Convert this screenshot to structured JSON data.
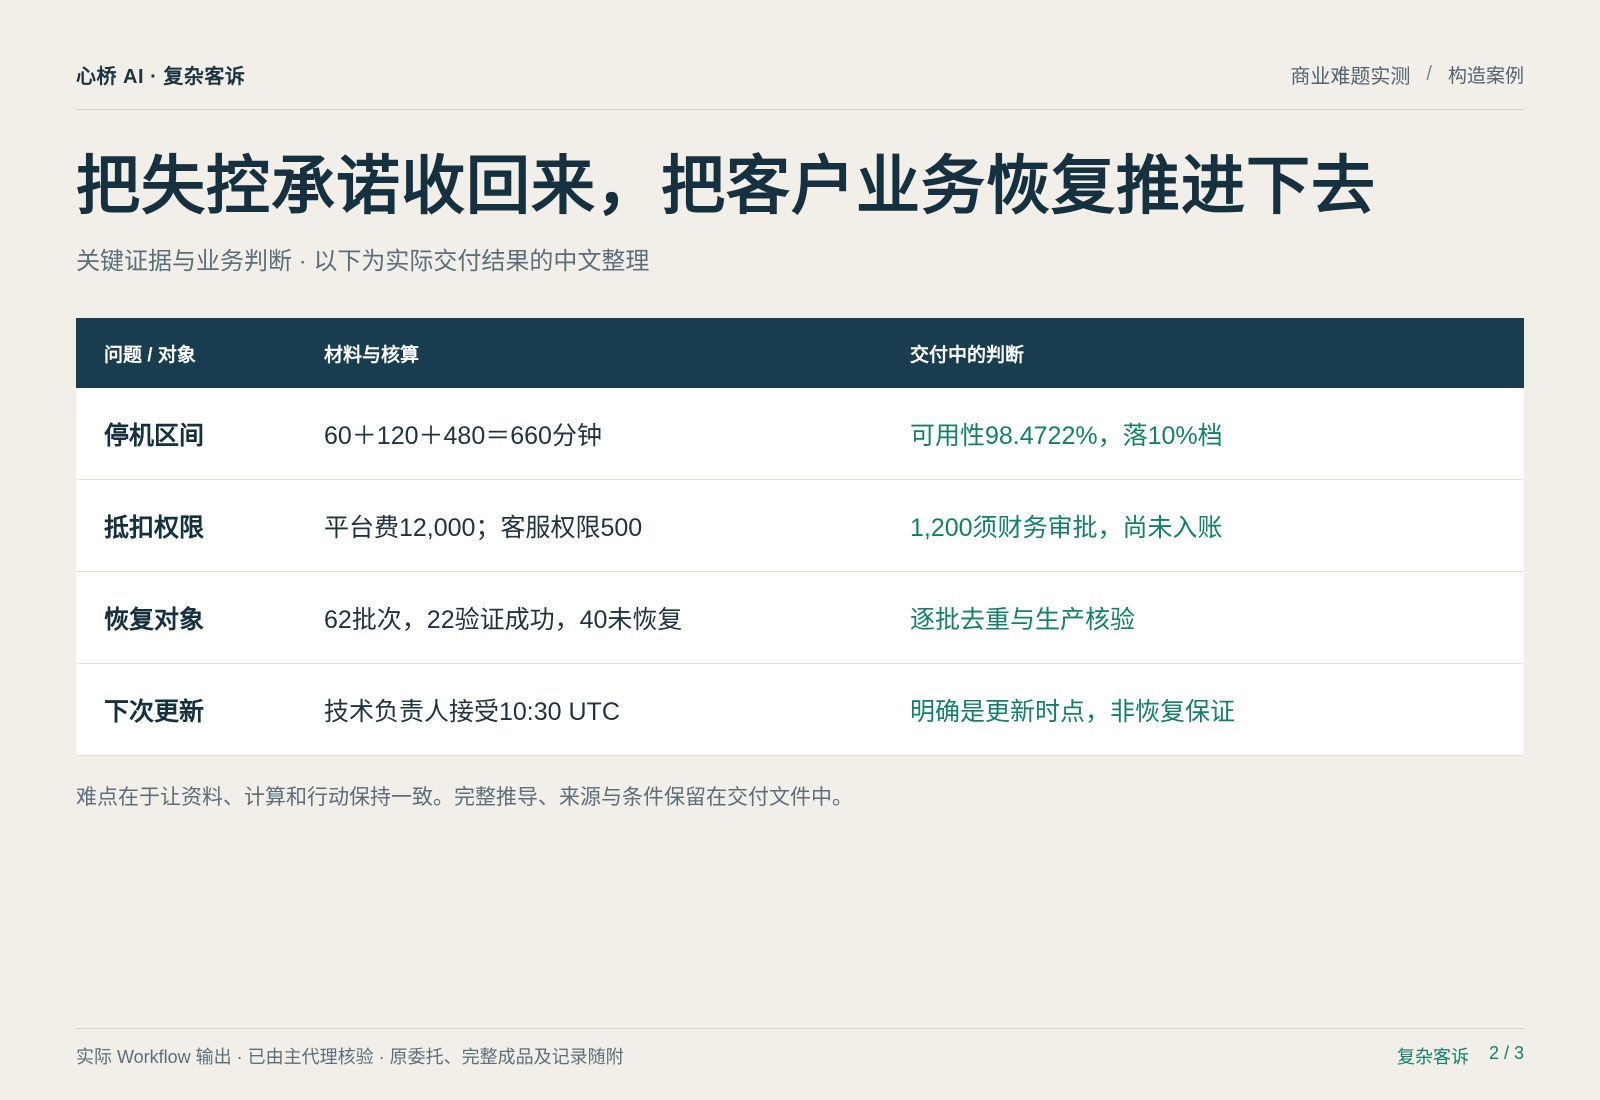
{
  "header": {
    "brand": "心桥 AI · 复杂客诉",
    "crumb1": "商业难题实测",
    "separator": "/",
    "crumb2": "构造案例"
  },
  "title": "把失控承诺收回来，把客户业务恢复推进下去",
  "subtitle": "关键证据与业务判断 · 以下为实际交付结果的中文整理",
  "table": {
    "headers": [
      "问题 / 对象",
      "材料与核算",
      "交付中的判断"
    ],
    "rows": [
      [
        "停机区间",
        "60＋120＋480＝660分钟",
        "可用性98.4722%，落10%档"
      ],
      [
        "抵扣权限",
        "平台费12,000；客服权限500",
        "1,200须财务审批，尚未入账"
      ],
      [
        "恢复对象",
        "62批次，22验证成功，40未恢复",
        "逐批去重与生产核验"
      ],
      [
        "下次更新",
        "技术负责人接受10:30 UTC",
        "明确是更新时点，非恢复保证"
      ]
    ]
  },
  "note": "难点在于让资料、计算和行动保持一致。完整推导、来源与条件保留在交付文件中。",
  "footer": {
    "left": "实际 Workflow 输出 · 已由主代理核验 · 原委托、完整成品及记录随附",
    "section": "复杂客诉",
    "page": "2 / 3"
  },
  "colors": {
    "background": "#f2efe9",
    "header_bg": "#183d4f",
    "accent": "#14806a",
    "text": "#15303e"
  }
}
